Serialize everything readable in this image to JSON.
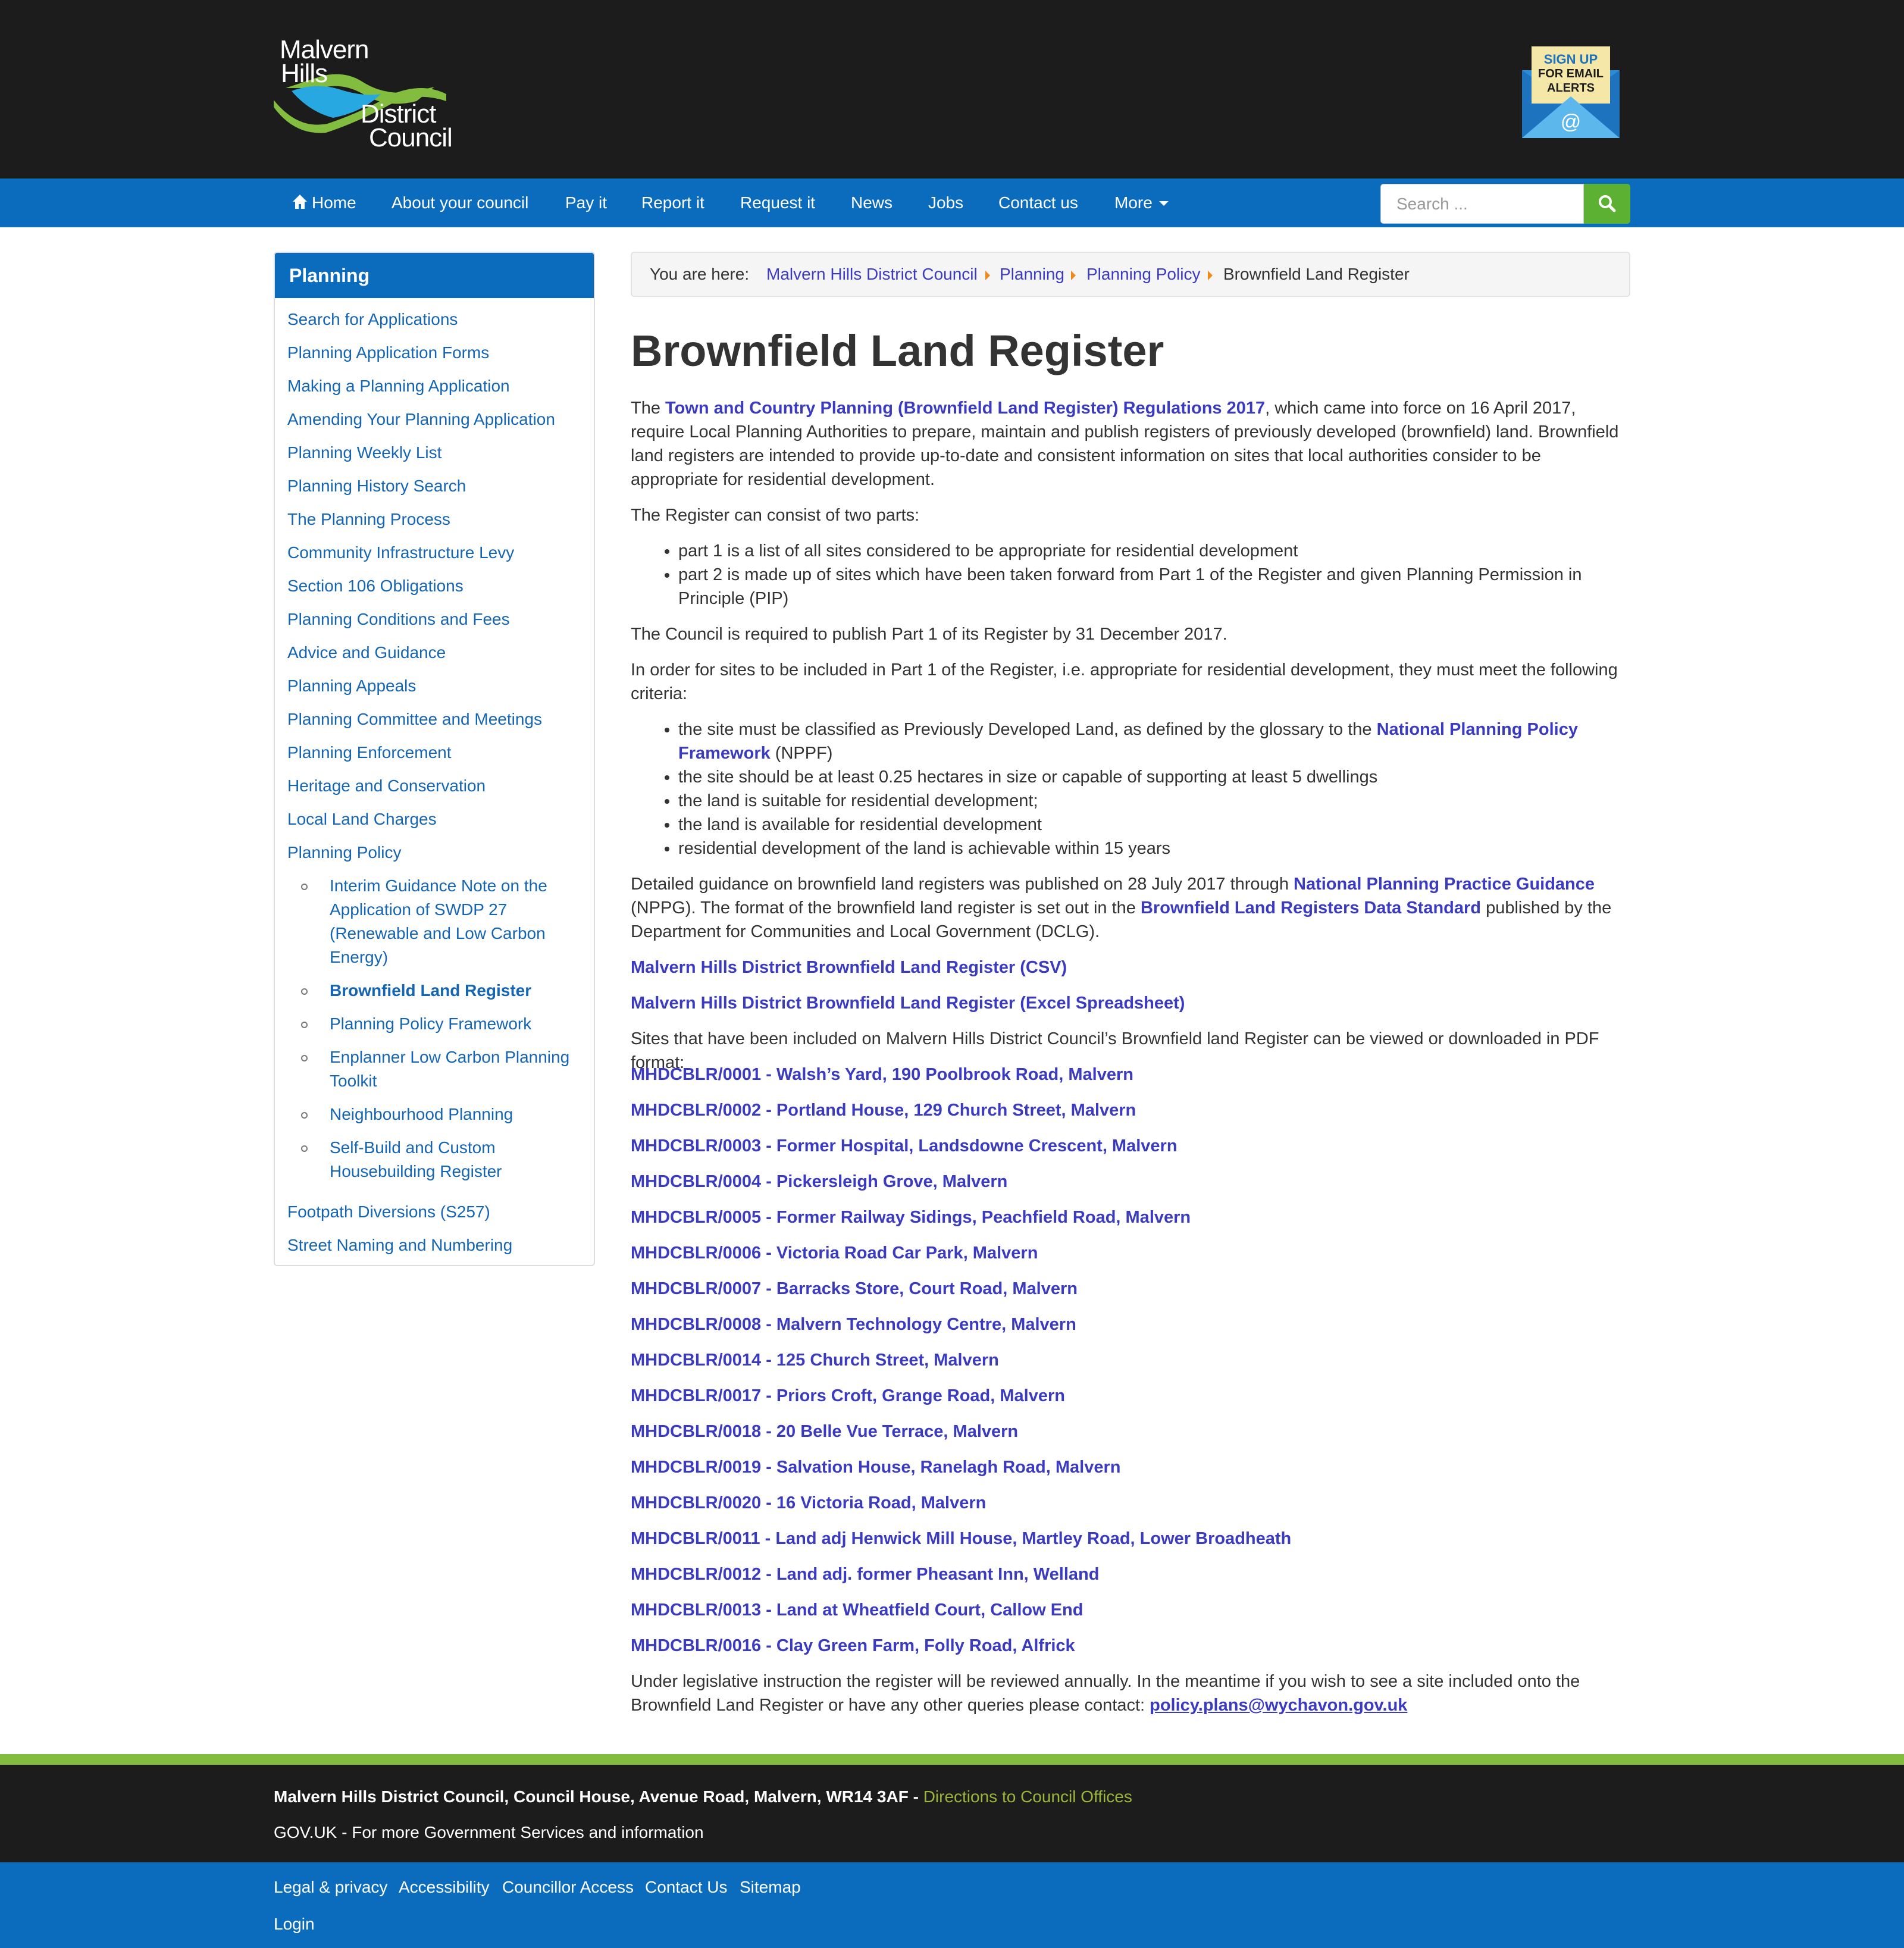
{
  "header": {
    "logo_line1": "Malvern",
    "logo_line2": "Hills",
    "logo_line3": "District",
    "logo_line4": "Council",
    "signup_line1": "SIGN UP",
    "signup_line2": "FOR EMAIL",
    "signup_line3": "ALERTS",
    "signup_at": "@"
  },
  "nav": {
    "home": "Home",
    "about": "About your council",
    "pay": "Pay it",
    "report": "Report it",
    "request": "Request it",
    "news": "News",
    "jobs": "Jobs",
    "contact": "Contact us",
    "more": "More",
    "search_placeholder": "Search ..."
  },
  "sidebar": {
    "title": "Planning",
    "items": [
      "Search for Applications",
      "Planning Application Forms",
      "Making a Planning Application",
      "Amending Your Planning Application",
      "Planning Weekly List",
      "Planning History Search",
      "The Planning Process",
      "Community Infrastructure Levy",
      "Section 106 Obligations",
      "Planning Conditions and Fees",
      "Advice and Guidance",
      "Planning Appeals",
      "Planning Committee and Meetings",
      "Planning Enforcement",
      "Heritage and Conservation",
      "Local Land Charges",
      "Planning Policy"
    ],
    "subitems": [
      "Interim Guidance Note on the Application of SWDP 27 (Renewable and Low Carbon Energy)",
      "Brownfield Land Register",
      "Planning Policy Framework",
      "Enplanner Low Carbon Planning Toolkit",
      "Neighbourhood Planning",
      "Self-Build and Custom Housebuilding Register"
    ],
    "bottom_items": [
      "Footpath Diversions (S257)",
      "Street Naming and Numbering"
    ]
  },
  "breadcrumb": {
    "prefix": "You are here:",
    "crumbs": [
      "Malvern Hills District Council",
      "Planning",
      "Planning Policy"
    ],
    "current": "Brownfield Land Register"
  },
  "content": {
    "title": "Brownfield Land Register",
    "p1_pre": "The ",
    "p1_link": "Town and Country Planning (Brownfield Land Register) Regulations 2017",
    "p1_post": ", which came into force on 16 April 2017, require Local Planning Authorities to prepare, maintain and publish registers of previously developed (brownfield) land.  Brownfield land registers are intended to provide up-to-date and consistent information on sites that local authorities consider to be appropriate for residential development.",
    "p2": "The Register can consist of two parts:",
    "parts": [
      "part 1 is a list of all sites considered to be appropriate for residential development",
      "part 2 is made up of sites which have been taken forward from Part 1 of the Register and given Planning Permission in Principle (PIP)"
    ],
    "p3": "The Council is required to publish Part 1 of its Register by 31 December 2017.",
    "p4": "In order for sites to be included in Part 1 of the Register, i.e. appropriate for residential development, they must meet the following criteria:",
    "crit1_pre": "the site must be classified as Previously Developed Land, as defined by the glossary to the ",
    "crit1_link": "National Planning Policy Framework",
    "crit1_post": " (NPPF)",
    "criteria": [
      "the site should be at least 0.25 hectares in size or capable of supporting at least 5 dwellings",
      "the land is suitable for residential development;",
      "the land is available for residential development",
      "residential development of the land is achievable within 15 years"
    ],
    "p5_a": "Detailed guidance on brownfield land registers was published on 28 July 2017 through ",
    "p5_link1": "National Planning Practice Guidance",
    "p5_b": " (NPPG). The format of the brownfield land register is set out in the ",
    "p5_link2": "Brownfield Land Registers Data Standard",
    "p5_c": " published by the Department for Communities and Local Government (DCLG).",
    "csv_link": "Malvern Hills District Brownfield Land Register (CSV)",
    "xls_link": "Malvern Hills District Brownfield Land Register (Excel Spreadsheet)",
    "p6": "Sites that have been included on Malvern Hills District Council’s Brownfield land Register can be viewed or downloaded in PDF format:",
    "sites": [
      "MHDCBLR/0001 - Walsh’s Yard, 190 Poolbrook Road, Malvern",
      "MHDCBLR/0002 - Portland House, 129 Church Street, Malvern",
      "MHDCBLR/0003 - Former Hospital, Landsdowne Crescent, Malvern",
      "MHDCBLR/0004 - Pickersleigh Grove, Malvern",
      "MHDCBLR/0005 - Former Railway Sidings, Peachfield Road, Malvern",
      "MHDCBLR/0006 - Victoria Road Car Park, Malvern",
      "MHDCBLR/0007 - Barracks Store, Court Road, Malvern",
      "MHDCBLR/0008 - Malvern Technology Centre, Malvern",
      "MHDCBLR/0014 - 125 Church Street, Malvern",
      "MHDCBLR/0017 - Priors Croft, Grange Road, Malvern",
      "MHDCBLR/0018 - 20 Belle Vue Terrace, Malvern",
      "MHDCBLR/0019 - Salvation House, Ranelagh Road, Malvern",
      "MHDCBLR/0020 - 16 Victoria Road, Malvern",
      "MHDCBLR/0011 - Land adj Henwick Mill House, Martley Road, Lower Broadheath",
      "MHDCBLR/0012 - Land adj. former Pheasant Inn, Welland",
      "MHDCBLR/0013 - Land at Wheatfield Court, Callow End",
      "MHDCBLR/0016 - Clay Green Farm, Folly Road, Alfrick"
    ],
    "p7": "Under legislative instruction the register will be reviewed annually. In the meantime if you wish to see a site included onto the Brownfield Land Register or have any other queries please contact: ",
    "email": "policy.plans@wychavon.gov.uk"
  },
  "footer": {
    "address": "Malvern Hills District Council, Council House, Avenue Road, Malvern, WR14 3AF - ",
    "directions": "Directions to Council Offices",
    "gov": "GOV.UK - For more Government Services and information",
    "links": [
      "Legal & privacy",
      "Accessibility",
      "Councillor Access",
      "Contact Us",
      "Sitemap"
    ],
    "login": "Login"
  },
  "colors": {
    "header_bg": "#1c1c1c",
    "nav_bg": "#0b6cbd",
    "link": "#3b3bc2",
    "side_link": "#1565b5",
    "search_btn": "#5cb132",
    "footer_green": "#82bd3f",
    "breadcrumb_arrow": "#ef8a17"
  }
}
